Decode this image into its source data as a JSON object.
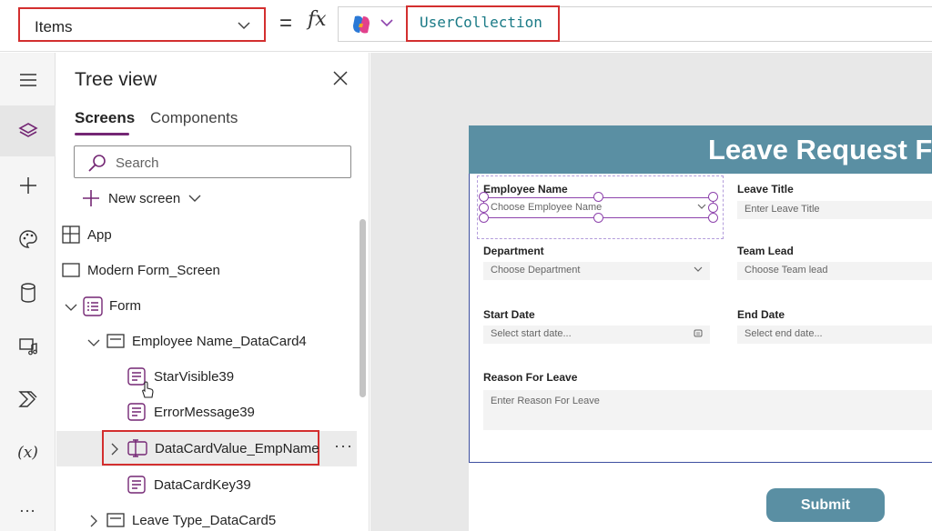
{
  "formula_bar": {
    "property": "Items",
    "equals": "=",
    "fx": "fx",
    "formula": "UserCollection"
  },
  "left_rail": {
    "items": [
      "hamburger-icon",
      "tree-view-icon",
      "insert-icon",
      "theme-icon",
      "data-icon",
      "media-icon",
      "power-automate-icon",
      "variables-icon",
      "more-icon"
    ],
    "variables_text": "(x)",
    "more_text": "..."
  },
  "tree_view": {
    "title": "Tree view",
    "tabs": [
      "Screens",
      "Components"
    ],
    "search_placeholder": "Search",
    "new_screen": "New screen",
    "items": [
      {
        "label": "App"
      },
      {
        "label": "Modern Form_Screen"
      },
      {
        "label": "Form"
      },
      {
        "label": "Employee Name_DataCard4"
      },
      {
        "label": "StarVisible39"
      },
      {
        "label": "ErrorMessage39"
      },
      {
        "label": "DataCardValue_EmpName"
      },
      {
        "label": "DataCardKey39"
      },
      {
        "label": "Leave Type_DataCard5"
      }
    ],
    "more_label": "···"
  },
  "canvas": {
    "header_title": "Leave Request F",
    "fields": {
      "employee_name": {
        "label": "Employee Name",
        "placeholder": "Choose Employee Name"
      },
      "leave_title": {
        "label": "Leave Title",
        "placeholder": "Enter Leave Title"
      },
      "department": {
        "label": "Department",
        "placeholder": "Choose Department"
      },
      "team_lead": {
        "label": "Team Lead",
        "placeholder": "Choose Team lead"
      },
      "start_date": {
        "label": "Start Date",
        "placeholder": "Select start date..."
      },
      "end_date": {
        "label": "End Date",
        "placeholder": "Select end date..."
      },
      "reason": {
        "label": "Reason For Leave",
        "placeholder": "Enter Reason For Leave"
      }
    },
    "submit_label": "Submit"
  },
  "colors": {
    "accent_purple": "#742774",
    "header_teal": "#5a8fa3",
    "highlight_red": "#d32f2f",
    "formula_teal": "#1a7a86"
  }
}
